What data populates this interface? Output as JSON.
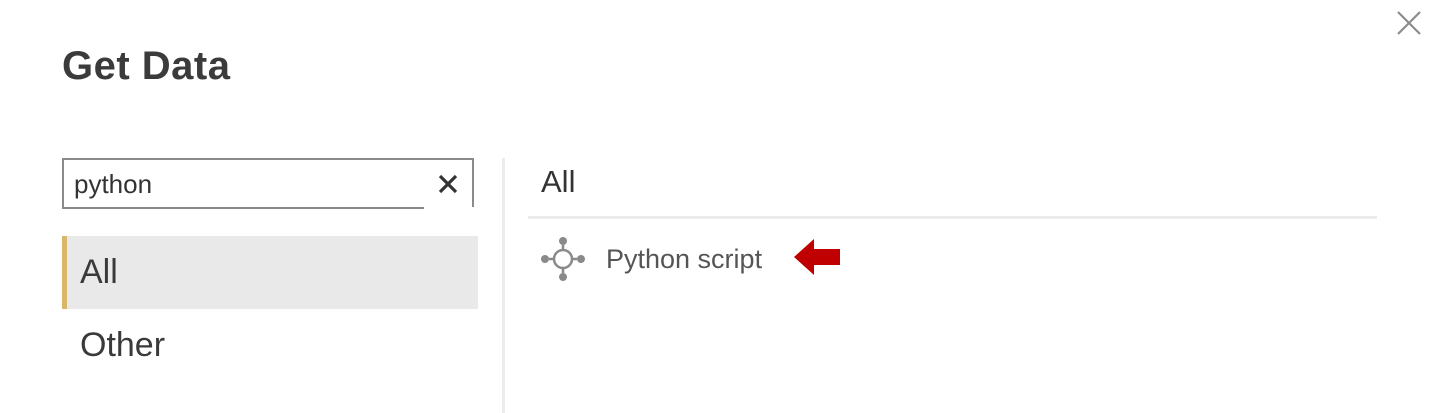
{
  "dialog": {
    "title": "Get Data"
  },
  "search": {
    "value": "python"
  },
  "categories": [
    {
      "label": "All",
      "selected": true
    },
    {
      "label": "Other",
      "selected": false
    }
  ],
  "results": {
    "header": "All",
    "items": [
      {
        "label": "Python script",
        "icon": "python-script-icon"
      }
    ]
  },
  "colors": {
    "accent": "#d8b76a",
    "selected_bg": "#e9e9e9",
    "arrow": "#c00000"
  }
}
